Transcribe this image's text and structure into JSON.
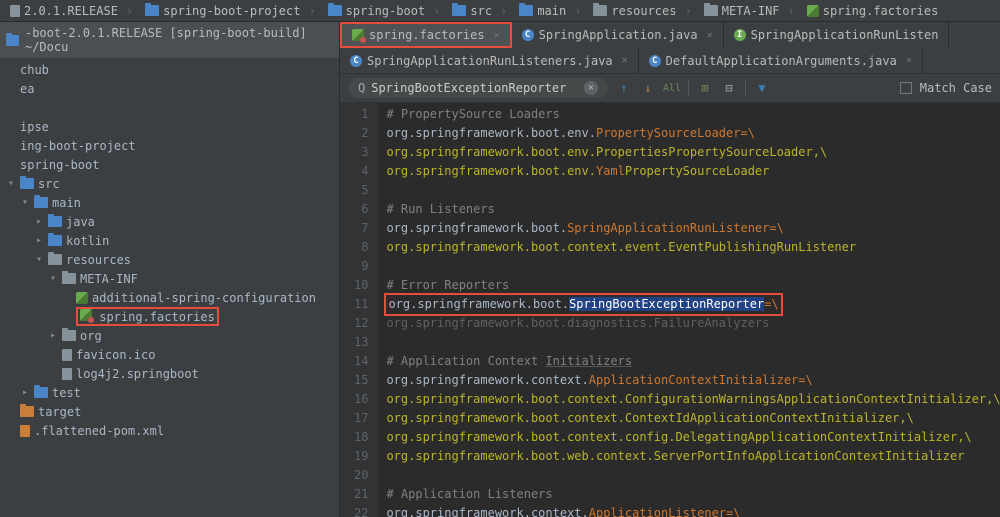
{
  "breadcrumbs": [
    {
      "label": "2.0.1.RELEASE",
      "icon": "file"
    },
    {
      "label": "spring-boot-project",
      "icon": "folder-blue"
    },
    {
      "label": "spring-boot",
      "icon": "folder-blue"
    },
    {
      "label": "src",
      "icon": "folder-blue"
    },
    {
      "label": "main",
      "icon": "folder-blue"
    },
    {
      "label": "resources",
      "icon": "folder"
    },
    {
      "label": "META-INF",
      "icon": "folder"
    },
    {
      "label": "spring.factories",
      "icon": "leaf"
    }
  ],
  "project": {
    "head": "-boot-2.0.1.RELEASE [spring-boot-build] ~/Docu"
  },
  "tree": [
    {
      "indent": 0,
      "arrow": "",
      "icon": "",
      "label": "chub"
    },
    {
      "indent": 0,
      "arrow": "",
      "icon": "",
      "label": "ea"
    },
    {
      "indent": 0,
      "arrow": "",
      "icon": "",
      "label": ""
    },
    {
      "indent": 0,
      "arrow": "",
      "icon": "",
      "label": "ipse"
    },
    {
      "indent": 0,
      "arrow": "",
      "icon": "",
      "label": "ing-boot-project"
    },
    {
      "indent": 0,
      "arrow": "",
      "icon": "",
      "label": "spring-boot"
    },
    {
      "indent": 0,
      "arrow": "▾",
      "icon": "folder-blue",
      "label": "src"
    },
    {
      "indent": 1,
      "arrow": "▾",
      "icon": "folder-blue",
      "label": "main"
    },
    {
      "indent": 2,
      "arrow": "▸",
      "icon": "folder-blue",
      "label": "java"
    },
    {
      "indent": 2,
      "arrow": "▸",
      "icon": "folder-blue",
      "label": "kotlin"
    },
    {
      "indent": 2,
      "arrow": "▾",
      "icon": "folder",
      "label": "resources"
    },
    {
      "indent": 3,
      "arrow": "▾",
      "icon": "folder",
      "label": "META-INF"
    },
    {
      "indent": 4,
      "arrow": "",
      "icon": "leaf",
      "label": "additional-spring-configuration"
    },
    {
      "indent": 4,
      "arrow": "",
      "icon": "leaf-star",
      "label": "spring.factories",
      "hl": true
    },
    {
      "indent": 3,
      "arrow": "▸",
      "icon": "folder",
      "label": "org"
    },
    {
      "indent": 3,
      "arrow": "",
      "icon": "file",
      "label": "favicon.ico"
    },
    {
      "indent": 3,
      "arrow": "",
      "icon": "file",
      "label": "log4j2.springboot"
    },
    {
      "indent": 1,
      "arrow": "▸",
      "icon": "folder-blue",
      "label": "test"
    },
    {
      "indent": 0,
      "arrow": "",
      "icon": "folder-orange",
      "label": "target"
    },
    {
      "indent": 0,
      "arrow": "",
      "icon": "xml",
      "label": ".flattened-pom.xml"
    }
  ],
  "tabs1": [
    {
      "label": "spring.factories",
      "icon": "leaf-star",
      "active": true,
      "hl": true
    },
    {
      "label": "SpringApplication.java",
      "icon": "c"
    },
    {
      "label": "SpringApplicationRunListen",
      "icon": "interface",
      "noclose": true
    }
  ],
  "tabs2": [
    {
      "label": "SpringApplicationRunListeners.java",
      "icon": "c"
    },
    {
      "label": "DefaultApplicationArguments.java",
      "icon": "c"
    }
  ],
  "find": {
    "value": "SpringBootExceptionReporter",
    "match_case": "Match Case"
  },
  "code": [
    {
      "n": 1,
      "seg": [
        {
          "t": "# PropertySource Loaders",
          "c": "cm"
        }
      ]
    },
    {
      "n": 2,
      "seg": [
        {
          "t": "org.springframework.boot.env.",
          "c": "pk"
        },
        {
          "t": "PropertySourceLoader",
          "c": "or"
        },
        {
          "t": "=\\",
          "c": "or"
        }
      ]
    },
    {
      "n": 3,
      "seg": [
        {
          "t": "org.springframework.boot.env.",
          "c": "yl"
        },
        {
          "t": "PropertiesPropertySourceLoader",
          "c": "yl"
        },
        {
          "t": ",\\",
          "c": "yl"
        }
      ]
    },
    {
      "n": 4,
      "seg": [
        {
          "t": "org.springframework.boot.env.",
          "c": "yl"
        },
        {
          "t": "Yaml",
          "c": "or"
        },
        {
          "t": "PropertySourceLoader",
          "c": "yl"
        }
      ]
    },
    {
      "n": 5,
      "seg": []
    },
    {
      "n": 6,
      "seg": [
        {
          "t": "# Run Listeners",
          "c": "cm"
        }
      ]
    },
    {
      "n": 7,
      "seg": [
        {
          "t": "org.springframework.boot.",
          "c": "pk"
        },
        {
          "t": "SpringApplicationRunListener",
          "c": "or"
        },
        {
          "t": "=\\",
          "c": "or"
        }
      ]
    },
    {
      "n": 8,
      "seg": [
        {
          "t": "org.springframework.boot.context.event.",
          "c": "yl"
        },
        {
          "t": "EventPublishingRunListener",
          "c": "yl"
        }
      ]
    },
    {
      "n": 9,
      "seg": []
    },
    {
      "n": 10,
      "seg": [
        {
          "t": "# Error Reporters",
          "c": "cm"
        }
      ]
    },
    {
      "n": 11,
      "seg": [
        {
          "t": "org.springframework.boot.",
          "c": "pk"
        },
        {
          "t": "SpringBootExceptionReporter",
          "c": "sel"
        },
        {
          "t": "=\\",
          "c": "or"
        }
      ],
      "hl": true
    },
    {
      "n": 12,
      "seg": [
        {
          "t": "org.springframework.boot.diagnostics.FailureAnalyzers",
          "c": "dim"
        }
      ]
    },
    {
      "n": 13,
      "seg": []
    },
    {
      "n": 14,
      "seg": [
        {
          "t": "# Application Context ",
          "c": "cm"
        },
        {
          "t": "Initializers",
          "c": "cm ul"
        }
      ]
    },
    {
      "n": 15,
      "seg": [
        {
          "t": "org.springframework.context.",
          "c": "pk"
        },
        {
          "t": "ApplicationContextInitializer",
          "c": "or"
        },
        {
          "t": "=\\",
          "c": "or"
        }
      ]
    },
    {
      "n": 16,
      "seg": [
        {
          "t": "org.springframework.boot.context.",
          "c": "yl"
        },
        {
          "t": "ConfigurationWarningsApplicationContextInitializer",
          "c": "yl"
        },
        {
          "t": ",\\",
          "c": "yl"
        }
      ]
    },
    {
      "n": 17,
      "seg": [
        {
          "t": "org.springframework.boot.context.",
          "c": "yl"
        },
        {
          "t": "ContextIdApplicationContextInitializer",
          "c": "yl"
        },
        {
          "t": ",\\",
          "c": "yl"
        }
      ]
    },
    {
      "n": 18,
      "seg": [
        {
          "t": "org.springframework.boot.context.config.",
          "c": "yl"
        },
        {
          "t": "DelegatingApplicationContextInitializer",
          "c": "yl"
        },
        {
          "t": ",\\",
          "c": "yl"
        }
      ]
    },
    {
      "n": 19,
      "seg": [
        {
          "t": "org.springframework.boot.web.context.",
          "c": "yl"
        },
        {
          "t": "ServerPortInfoApplicationContextInitializer",
          "c": "yl"
        }
      ]
    },
    {
      "n": 20,
      "seg": []
    },
    {
      "n": 21,
      "seg": [
        {
          "t": "# Application Listeners",
          "c": "cm"
        }
      ]
    },
    {
      "n": 22,
      "seg": [
        {
          "t": "org.springframework.context.",
          "c": "pk"
        },
        {
          "t": "ApplicationListener",
          "c": "or"
        },
        {
          "t": "=\\",
          "c": "or"
        }
      ]
    }
  ]
}
